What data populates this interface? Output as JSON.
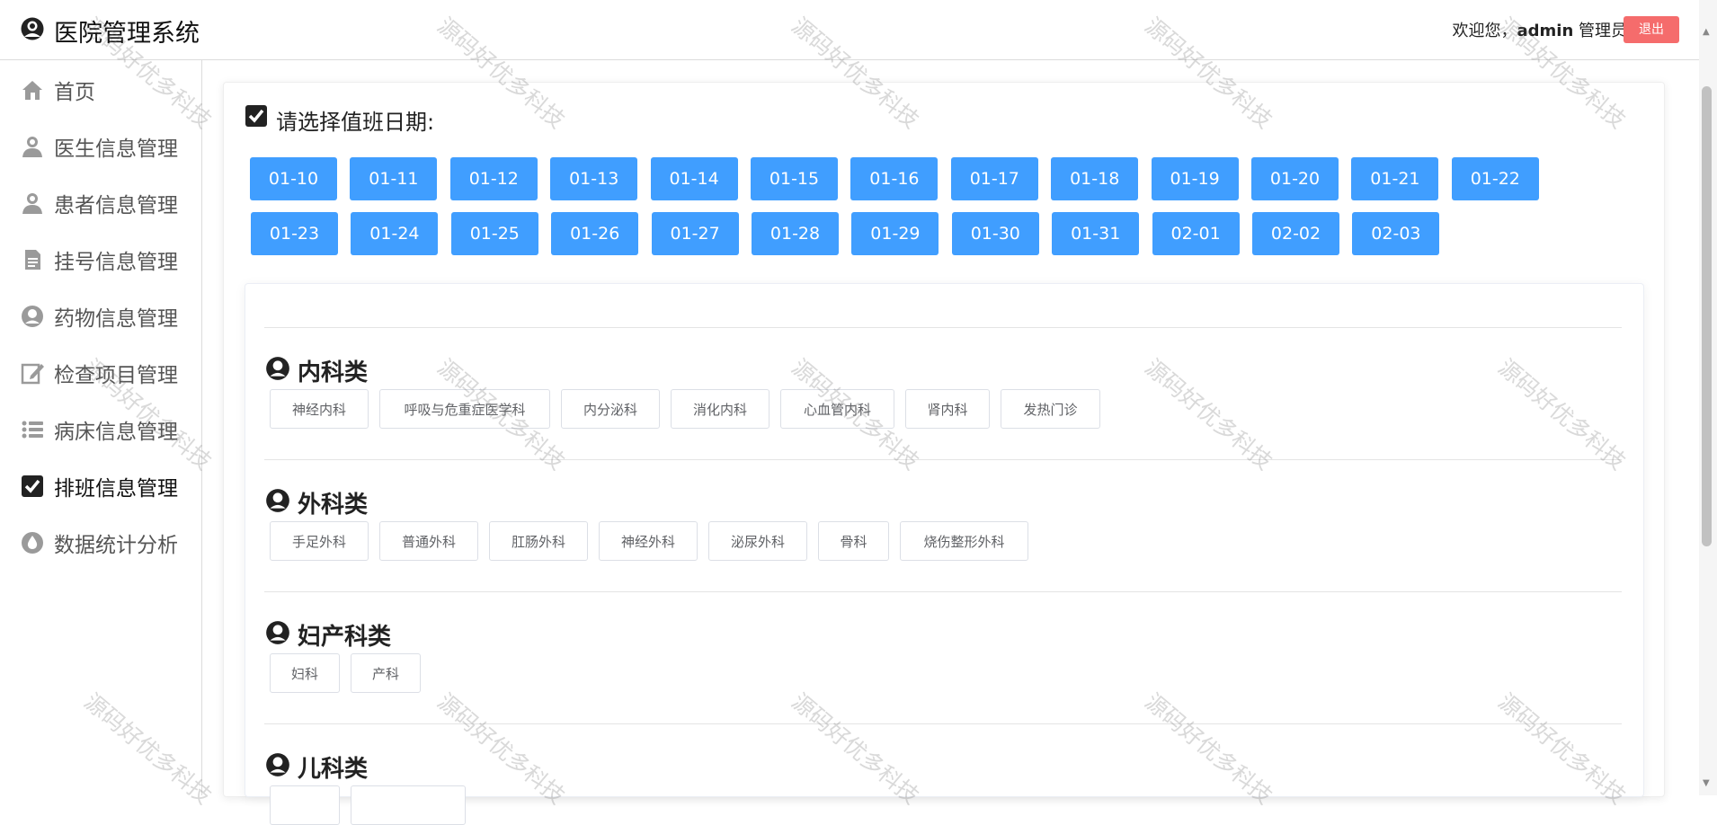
{
  "header": {
    "app_title": "医院管理系统",
    "welcome_prefix": "欢迎您，",
    "username": "admin",
    "role": "管理员",
    "logout_label": "退出"
  },
  "sidebar": {
    "items": [
      {
        "label": "首页",
        "icon": "home-icon"
      },
      {
        "label": "医生信息管理",
        "icon": "doctor-icon"
      },
      {
        "label": "患者信息管理",
        "icon": "patient-icon"
      },
      {
        "label": "挂号信息管理",
        "icon": "document-icon"
      },
      {
        "label": "药物信息管理",
        "icon": "medicine-icon"
      },
      {
        "label": "检查项目管理",
        "icon": "edit-icon"
      },
      {
        "label": "病床信息管理",
        "icon": "list-icon"
      },
      {
        "label": "排班信息管理",
        "icon": "checkbox-icon"
      },
      {
        "label": "数据统计分析",
        "icon": "drop-icon"
      }
    ],
    "active_index": 7
  },
  "schedule": {
    "heading": "请选择值班日期:",
    "dates": [
      "01-10",
      "01-11",
      "01-12",
      "01-13",
      "01-14",
      "01-15",
      "01-16",
      "01-17",
      "01-18",
      "01-19",
      "01-20",
      "01-21",
      "01-22",
      "01-23",
      "01-24",
      "01-25",
      "01-26",
      "01-27",
      "01-28",
      "01-29",
      "01-30",
      "01-31",
      "02-01",
      "02-02",
      "02-03"
    ]
  },
  "categories": [
    {
      "title": "内科类",
      "departments": [
        "神经内科",
        "呼吸与危重症医学科",
        "内分泌科",
        "消化内科",
        "心血管内科",
        "肾内科",
        "发热门诊"
      ]
    },
    {
      "title": "外科类",
      "departments": [
        "手足外科",
        "普通外科",
        "肛肠外科",
        "神经外科",
        "泌尿外科",
        "骨科",
        "烧伤整形外科"
      ]
    },
    {
      "title": "妇产科类",
      "departments": [
        "妇科",
        "产科"
      ]
    },
    {
      "title": "儿科类",
      "departments": [
        "",
        ""
      ]
    }
  ],
  "watermark_text": "源码好优多科技",
  "colors": {
    "primary": "#409eff",
    "danger": "#f56c6c",
    "text": "#333333"
  }
}
